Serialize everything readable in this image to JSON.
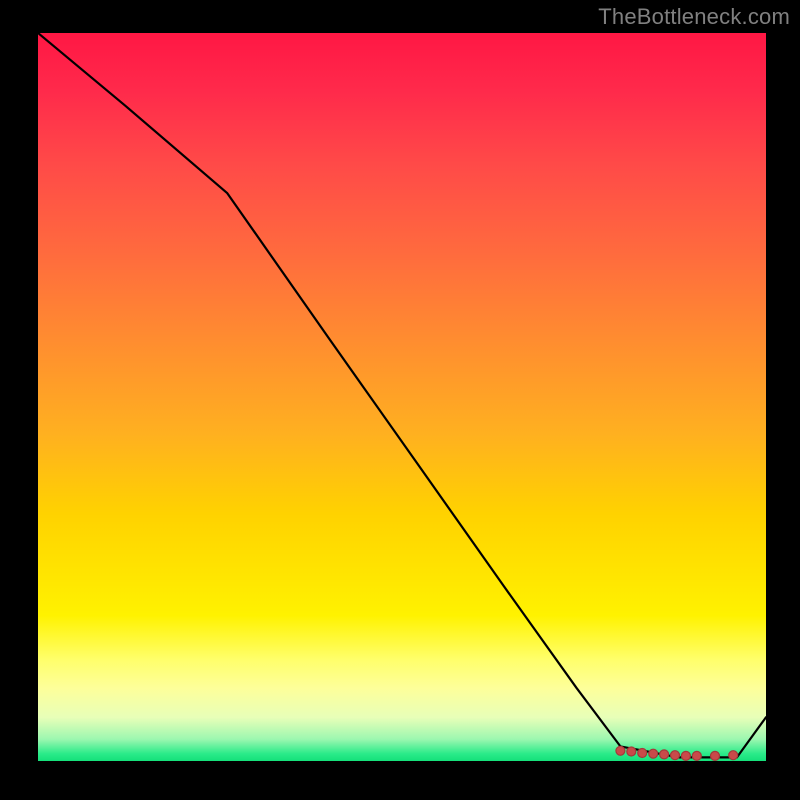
{
  "attribution": "TheBottleneck.com",
  "chart_data": {
    "type": "line",
    "title": "",
    "xlabel": "",
    "ylabel": "",
    "xlim": [
      0,
      100
    ],
    "ylim": [
      0,
      100
    ],
    "x": [
      0,
      12,
      26,
      40,
      52,
      64,
      74,
      80,
      88,
      96,
      100
    ],
    "values": [
      100,
      90,
      78,
      58,
      41,
      24,
      10,
      2,
      0.5,
      0.5,
      6
    ],
    "markers_x": [
      80,
      81.5,
      83,
      84.5,
      86,
      87.5,
      89,
      90.5,
      93,
      95.5
    ],
    "markers_y": [
      1.4,
      1.3,
      1.1,
      1.0,
      0.9,
      0.8,
      0.7,
      0.7,
      0.7,
      0.8
    ],
    "gradient_note": "vertical red→orange→yellow→green background",
    "legend": []
  }
}
